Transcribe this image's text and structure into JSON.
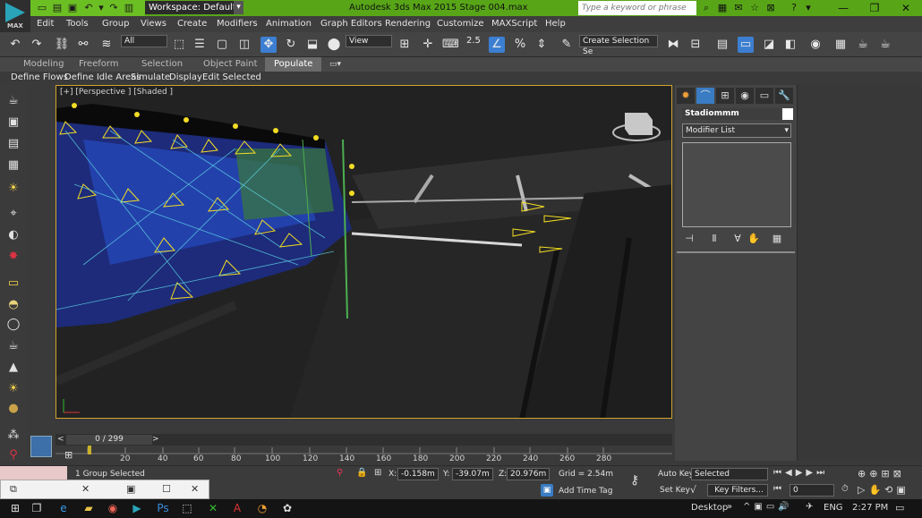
{
  "titlebar": {
    "workspace": "Workspace: Default",
    "app_title": "Autodesk 3ds Max  2015      Stage 004.max",
    "search_placeholder": "Type a keyword or phrase",
    "logo_text": "MAX"
  },
  "menu": [
    "Edit",
    "Tools",
    "Group",
    "Views",
    "Create",
    "Modifiers",
    "Animation",
    "Graph Editors",
    "Rendering",
    "Customize",
    "MAXScript",
    "Help"
  ],
  "toolbar": {
    "selection_filter": "All",
    "ref_coord": "View",
    "snap_value": "2.5",
    "named_selection": "Create Selection Se"
  },
  "ribbon": {
    "tabs": [
      "Modeling",
      "Freeform",
      "Selection",
      "Object Paint",
      "Populate"
    ],
    "selected_tab": "Populate",
    "sub_items": [
      "Define Flows",
      "Define Idle Areas",
      "Simulate",
      "Display",
      "Edit Selected"
    ]
  },
  "viewport": {
    "label": "[+] [Perspective ] [Shaded ]"
  },
  "command_panel": {
    "object_name": "Stadiommm",
    "modifier_list": "Modifier List"
  },
  "timeline": {
    "frame_display": "0 / 299",
    "ticks": [
      "20",
      "40",
      "60",
      "80",
      "100",
      "120",
      "140",
      "160",
      "180",
      "200",
      "220",
      "240",
      "260",
      "280"
    ]
  },
  "status": {
    "selection_info": "1 Group Selected",
    "x_value": "-0.158m",
    "y_value": "-39.07m",
    "z_value": "20.976m",
    "grid": "Grid = 2.54m",
    "add_time_tag": "Add Time Tag",
    "auto_key": "Auto Key",
    "set_key": "Set Key",
    "selected_dropdown": "Selected",
    "key_filters": "Key Filters...",
    "frame_field": "0",
    "x_label": "X:",
    "y_label": "Y:",
    "z_label": "Z:"
  },
  "taskbar": {
    "desktop": "Desktop",
    "language": "ENG",
    "time": "2:27 PM"
  }
}
